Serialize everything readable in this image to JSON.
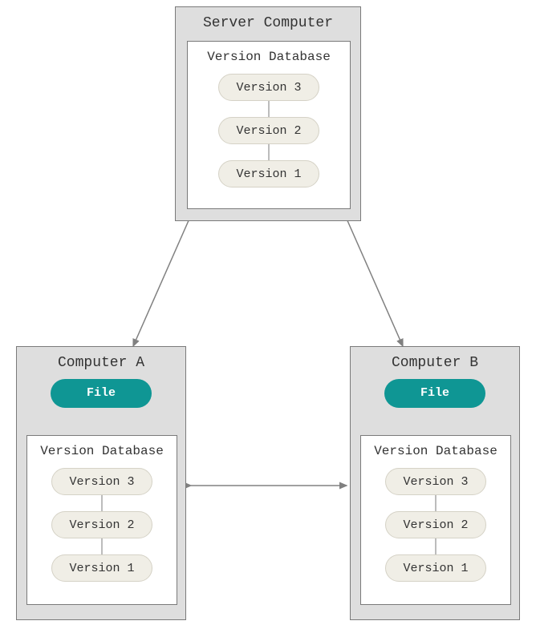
{
  "server": {
    "title": "Server Computer",
    "db_title": "Version Database",
    "versions": {
      "v3": "Version 3",
      "v2": "Version 2",
      "v1": "Version 1"
    }
  },
  "computerA": {
    "title": "Computer A",
    "file_label": "File",
    "db_title": "Version Database",
    "versions": {
      "v3": "Version 3",
      "v2": "Version 2",
      "v1": "Version 1"
    }
  },
  "computerB": {
    "title": "Computer B",
    "file_label": "File",
    "db_title": "Version Database",
    "versions": {
      "v3": "Version 3",
      "v2": "Version 2",
      "v1": "Version 1"
    }
  }
}
